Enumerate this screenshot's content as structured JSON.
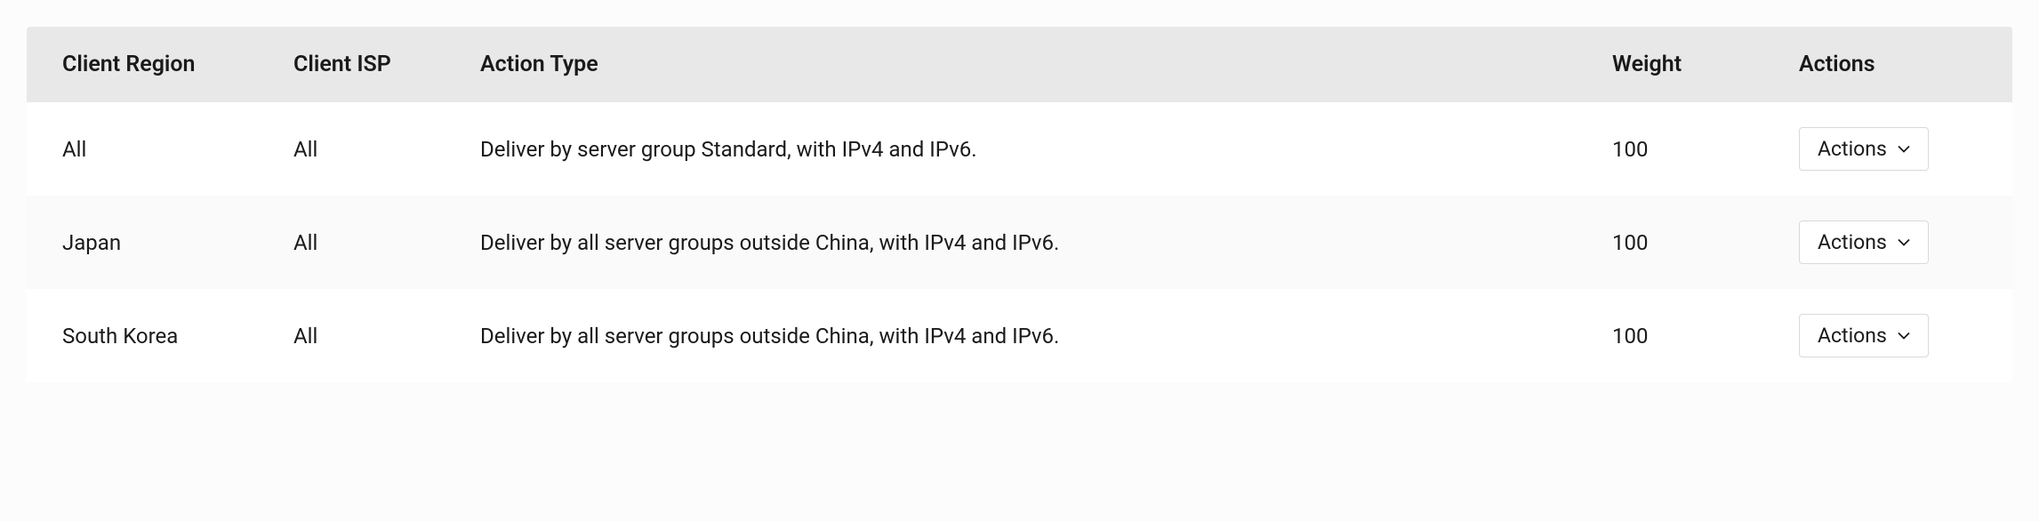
{
  "table": {
    "headers": {
      "client_region": "Client Region",
      "client_isp": "Client ISP",
      "action_type": "Action Type",
      "weight": "Weight",
      "actions": "Actions"
    },
    "rows": [
      {
        "client_region": "All",
        "client_isp": "All",
        "action_type": "Deliver by server group Standard, with IPv4 and IPv6.",
        "weight": "100",
        "actions_label": "Actions"
      },
      {
        "client_region": "Japan",
        "client_isp": "All",
        "action_type": "Deliver by all server groups outside China, with IPv4 and IPv6.",
        "weight": "100",
        "actions_label": "Actions"
      },
      {
        "client_region": "South Korea",
        "client_isp": "All",
        "action_type": "Deliver by all server groups outside China, with IPv4 and IPv6.",
        "weight": "100",
        "actions_label": "Actions"
      }
    ]
  }
}
